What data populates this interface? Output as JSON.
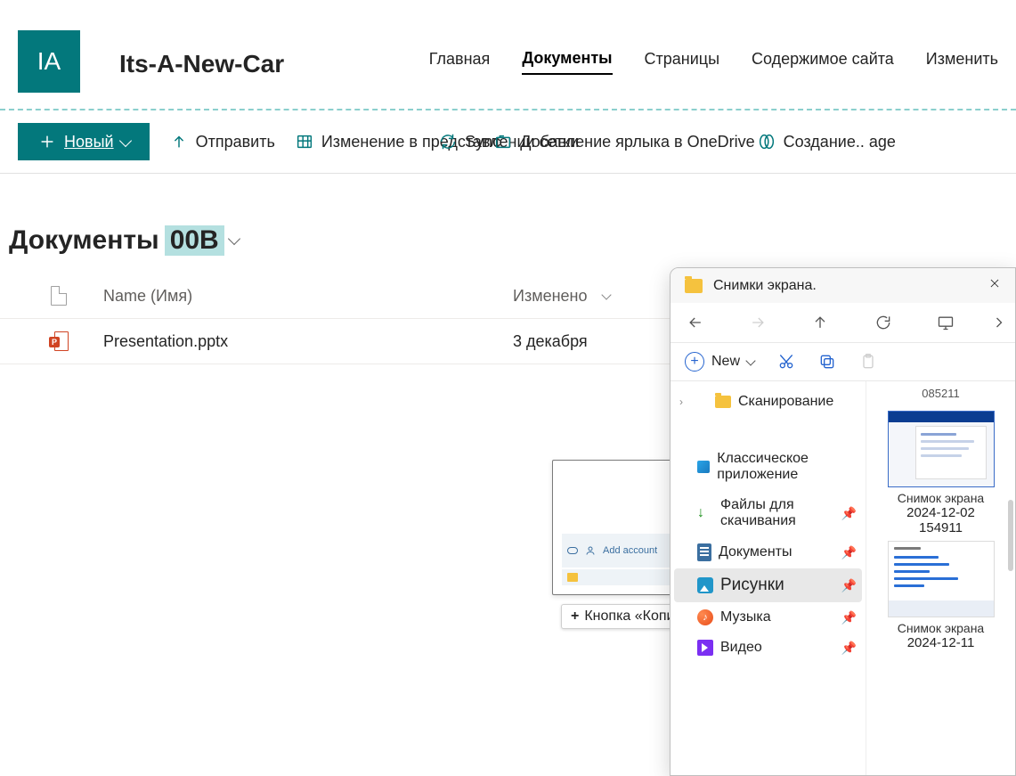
{
  "site": {
    "logo_initials": "IA",
    "title": "Its-A-New-Car"
  },
  "top_nav": [
    {
      "label": "Главная",
      "active": false
    },
    {
      "label": "Документы",
      "active": true
    },
    {
      "label": "Страницы",
      "active": false
    },
    {
      "label": "Содержимое сайта",
      "active": false
    },
    {
      "label": "Изменить",
      "active": false
    }
  ],
  "cmdbar": {
    "new": "Новый",
    "upload": "Отправить",
    "grid": "Изменение в представлении сетки",
    "sync": "Sync",
    "shortcut": "Добавление ярлыка в OneDrive",
    "create": "Создание..  age"
  },
  "library": {
    "title_prefix": "Документы",
    "title_badge": "00B"
  },
  "columns": {
    "name": "Name (Имя)",
    "modified": "Изменено"
  },
  "rows": [
    {
      "name": "Presentation.pptx",
      "modified": "3 декабря",
      "type": "pptx"
    }
  ],
  "drag": {
    "thumb_text": "Add account",
    "tooltip": "Кнопка «Копировать»."
  },
  "explorer": {
    "title": "Снимки экрана.",
    "new": "New",
    "tree": {
      "scan": "Сканирование",
      "classic_app": "Классическое приложение",
      "downloads": "Файлы для скачивания",
      "documents": "Документы",
      "pictures": "Рисунки",
      "music": "Музыка",
      "video": "Видео"
    },
    "content": {
      "frag_top": "085211",
      "item1_line1": "Снимок экрана",
      "item1_line2": "2024-12-02",
      "item1_line3": "154911",
      "item2_line1": "Снимок экрана",
      "item2_line2": "2024-12-11"
    }
  }
}
